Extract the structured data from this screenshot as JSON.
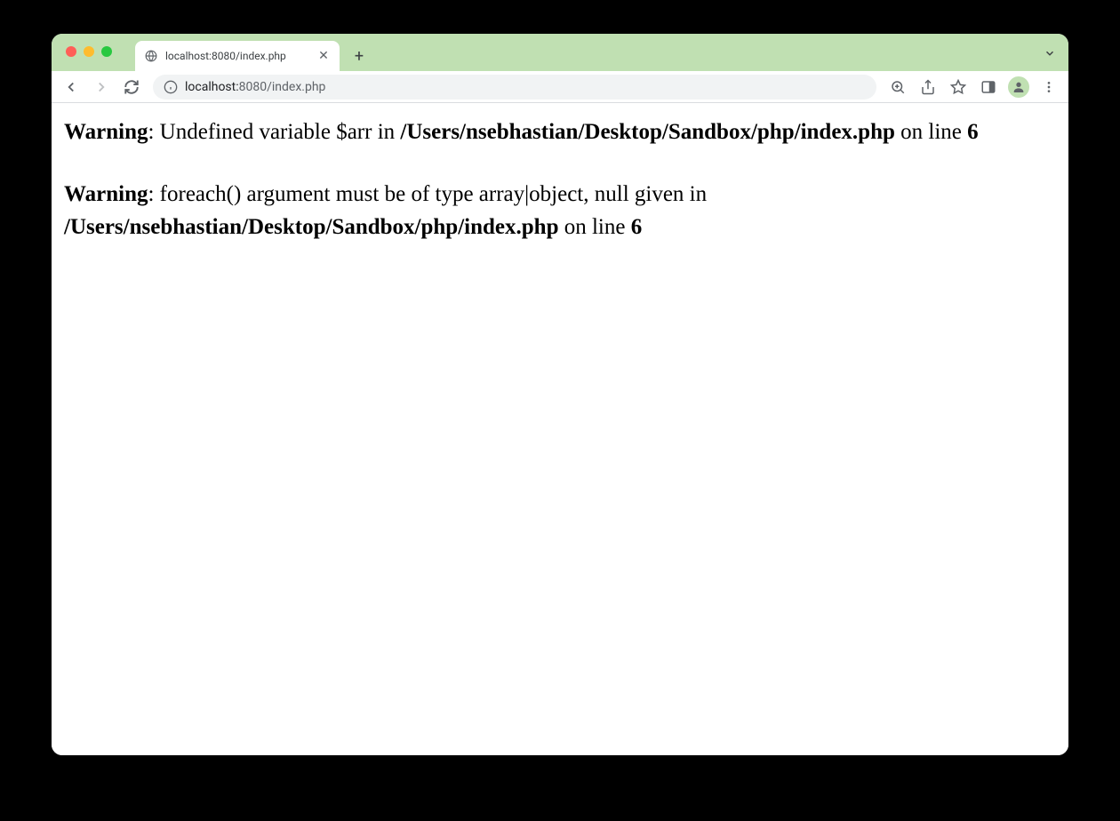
{
  "window": {
    "tab": {
      "title": "localhost:8080/index.php"
    },
    "address": {
      "host": "localhost:",
      "path": "8080/index.php"
    }
  },
  "page": {
    "warnings": [
      {
        "label": "Warning",
        "message": ": Undefined variable $arr in ",
        "file": "/Users/nsebhastian/Desktop/Sandbox/php/index.php",
        "on_line": " on line ",
        "line_number": "6"
      },
      {
        "label": "Warning",
        "message": ": foreach() argument must be of type array|object, null given in ",
        "file": "/Users/nsebhastian/Desktop/Sandbox/php/index.php",
        "on_line": " on line ",
        "line_number": "6"
      }
    ]
  }
}
